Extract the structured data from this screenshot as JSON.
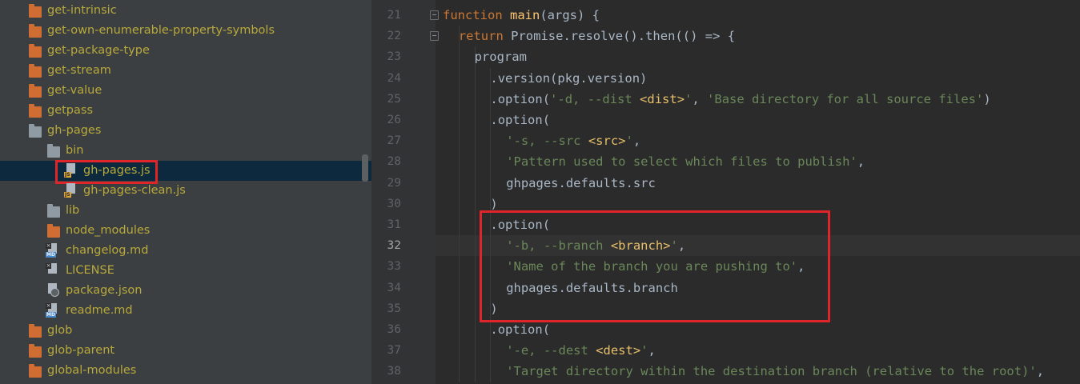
{
  "tree": {
    "items": [
      {
        "type": "folder",
        "color": "orange",
        "label": "get-intrinsic",
        "arrow": "›",
        "depth": 0
      },
      {
        "type": "folder",
        "color": "orange",
        "label": "get-own-enumerable-property-symbols",
        "arrow": "›",
        "depth": 0
      },
      {
        "type": "folder",
        "color": "orange",
        "label": "get-package-type",
        "arrow": "›",
        "depth": 0
      },
      {
        "type": "folder",
        "color": "orange",
        "label": "get-stream",
        "arrow": "›",
        "depth": 0
      },
      {
        "type": "folder",
        "color": "orange",
        "label": "get-value",
        "arrow": "›",
        "depth": 0
      },
      {
        "type": "folder",
        "color": "orange",
        "label": "getpass",
        "arrow": "›",
        "depth": 0
      },
      {
        "type": "folder",
        "color": "gray",
        "label": "gh-pages",
        "arrow": "⌄",
        "depth": 0
      },
      {
        "type": "folder",
        "color": "gray",
        "label": "bin",
        "arrow": "⌄",
        "depth": 1
      },
      {
        "type": "file",
        "badge": "JS",
        "label": "gh-pages.js",
        "depth": 2,
        "selected": true,
        "highlighted": true
      },
      {
        "type": "file",
        "badge": "JS",
        "label": "gh-pages-clean.js",
        "depth": 2
      },
      {
        "type": "folder",
        "color": "gray",
        "label": "lib",
        "arrow": "›",
        "depth": 1
      },
      {
        "type": "folder",
        "color": "orange",
        "label": "node_modules",
        "arrow": "›",
        "depth": 1
      },
      {
        "type": "file",
        "badge": "MD",
        "label": "changelog.md",
        "depth": 1
      },
      {
        "type": "file",
        "badge": "TXT",
        "label": "LICENSE",
        "depth": 1
      },
      {
        "type": "file",
        "badge": "JSON",
        "label": "package.json",
        "depth": 1
      },
      {
        "type": "file",
        "badge": "MD",
        "label": "readme.md",
        "depth": 1
      },
      {
        "type": "folder",
        "color": "orange",
        "label": "glob",
        "arrow": "›",
        "depth": 0
      },
      {
        "type": "folder",
        "color": "orange",
        "label": "glob-parent",
        "arrow": "›",
        "depth": 0
      },
      {
        "type": "folder",
        "color": "orange",
        "label": "global-modules",
        "arrow": "›",
        "depth": 0
      }
    ]
  },
  "editor": {
    "current_line": 32,
    "highlight_range": [
      31,
      35
    ],
    "lines": [
      {
        "num": "21",
        "fold": true,
        "indent": 0,
        "tokens": [
          {
            "t": "function",
            "c": "kw"
          },
          {
            "t": " "
          },
          {
            "t": "main",
            "c": "fn"
          },
          {
            "t": "(args) {"
          }
        ]
      },
      {
        "num": "22",
        "fold": true,
        "indent": 2,
        "tokens": [
          {
            "t": "return",
            "c": "kw"
          },
          {
            "t": " Promise.resolve().then(() => {"
          }
        ]
      },
      {
        "num": "23",
        "indent": 4,
        "tokens": [
          {
            "t": "program"
          }
        ]
      },
      {
        "num": "24",
        "indent": 6,
        "tokens": [
          {
            "t": ".version(pkg.version)"
          }
        ]
      },
      {
        "num": "25",
        "indent": 6,
        "tokens": [
          {
            "t": ".option("
          },
          {
            "t": "'-d, --dist ",
            "c": "str"
          },
          {
            "t": "<dist>",
            "c": "tag"
          },
          {
            "t": "'",
            "c": "str"
          },
          {
            "t": ", "
          },
          {
            "t": "'Base directory for all source files'",
            "c": "str"
          },
          {
            "t": ")"
          }
        ]
      },
      {
        "num": "26",
        "indent": 6,
        "tokens": [
          {
            "t": ".option("
          }
        ]
      },
      {
        "num": "27",
        "indent": 8,
        "tokens": [
          {
            "t": "'-s, --src ",
            "c": "str"
          },
          {
            "t": "<src>",
            "c": "tag"
          },
          {
            "t": "'",
            "c": "str"
          },
          {
            "t": ","
          }
        ]
      },
      {
        "num": "28",
        "indent": 8,
        "tokens": [
          {
            "t": "'Pattern used to select which files to publish'",
            "c": "str"
          },
          {
            "t": ","
          }
        ]
      },
      {
        "num": "29",
        "indent": 8,
        "tokens": [
          {
            "t": "ghpages.defaults.src"
          }
        ]
      },
      {
        "num": "30",
        "indent": 6,
        "tokens": [
          {
            "t": ")"
          }
        ]
      },
      {
        "num": "31",
        "indent": 6,
        "tokens": [
          {
            "t": ".option("
          }
        ]
      },
      {
        "num": "32",
        "indent": 8,
        "tokens": [
          {
            "t": "'-b, --branch ",
            "c": "str"
          },
          {
            "t": "<branch>",
            "c": "tag"
          },
          {
            "t": "'",
            "c": "str"
          },
          {
            "t": ","
          }
        ]
      },
      {
        "num": "33",
        "indent": 8,
        "tokens": [
          {
            "t": "'Name of the branch you are pushing to'",
            "c": "str"
          },
          {
            "t": ","
          }
        ]
      },
      {
        "num": "34",
        "indent": 8,
        "tokens": [
          {
            "t": "ghpages.defaults.branch"
          }
        ]
      },
      {
        "num": "35",
        "indent": 6,
        "tokens": [
          {
            "t": ")"
          }
        ]
      },
      {
        "num": "36",
        "indent": 6,
        "tokens": [
          {
            "t": ".option("
          }
        ]
      },
      {
        "num": "37",
        "indent": 8,
        "tokens": [
          {
            "t": "'-e, --dest ",
            "c": "str"
          },
          {
            "t": "<dest>",
            "c": "tag"
          },
          {
            "t": "'",
            "c": "str"
          },
          {
            "t": ","
          }
        ]
      },
      {
        "num": "38",
        "indent": 8,
        "tokens": [
          {
            "t": "'Target directory within the destination branch (relative to the root)'",
            "c": "str"
          },
          {
            "t": ","
          }
        ]
      }
    ]
  },
  "colors": {
    "tree_bg": "#3c3f41",
    "editor_bg": "#2b2b2b",
    "highlight_border": "#e0252a",
    "folder_orange": "#d06d33",
    "folder_gray": "#8f9aa3",
    "label_color": "#b8a93a"
  }
}
